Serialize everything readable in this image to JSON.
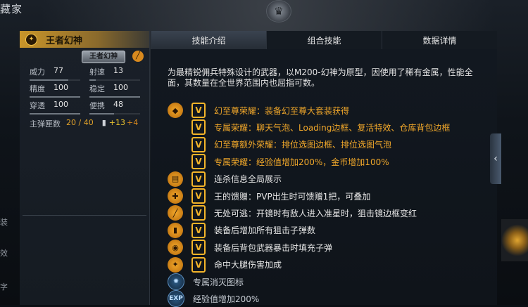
{
  "header": {
    "title": "藏家",
    "logo_icon": "lion-emblem-icon"
  },
  "side_hints": [
    "效",
    "字",
    "装"
  ],
  "weapon": {
    "name": "王者幻神",
    "badge": "王者幻神",
    "stats": [
      {
        "label": "威力",
        "value": "77",
        "level": 0.77
      },
      {
        "label": "射速",
        "value": "13",
        "level": 0.13
      },
      {
        "label": "精度",
        "value": "100",
        "level": 1.0
      },
      {
        "label": "稳定",
        "value": "100",
        "level": 1.0
      },
      {
        "label": "穿透",
        "value": "100",
        "level": 1.0
      },
      {
        "label": "便携",
        "value": "48",
        "level": 0.48
      }
    ],
    "ammo": {
      "label": "主弹匣数",
      "value": "20 / 40",
      "extra": "+13",
      "extra2": "+4"
    }
  },
  "tabs": [
    {
      "label": "技能介绍",
      "active": true
    },
    {
      "label": "组合技能",
      "active": false
    },
    {
      "label": "数据详情",
      "active": false
    }
  ],
  "description": "为最精锐佣兵特殊设计的武器，以M200-幻神为原型，因使用了稀有金属，性能全面，其数量在全世界范围内也屈指可数。",
  "features": [
    {
      "icon": "diamond-emblem-icon",
      "vip": true,
      "text": "幻至尊荣耀：装备幻至尊大套装获得",
      "color": "gold"
    },
    {
      "icon": "",
      "vip": true,
      "text": "专属荣耀：聊天气泡、Loading边框、复活特效、仓库背包边框",
      "color": "gold"
    },
    {
      "icon": "",
      "vip": true,
      "text": "幻至尊额外荣耀：排位选图边框、排位选图气泡",
      "color": "gold"
    },
    {
      "icon": "",
      "vip": true,
      "text": "专属荣耀：经验值增加200%，金币增加100%",
      "color": "gold"
    },
    {
      "icon": "killfeed-icon",
      "vip": true,
      "text": "连杀信息全局展示",
      "color": "white"
    },
    {
      "icon": "gift-icon",
      "vip": true,
      "text": "王的馈赠：PVP出生时可馈赠1把，可叠加",
      "color": "white"
    },
    {
      "icon": "sniper-scope-icon",
      "vip": true,
      "text": "无处可逃：开镜时有敌人进入准星时，狙击镜边框变红",
      "color": "white"
    },
    {
      "icon": "ammo-icon",
      "vip": true,
      "text": "装备后增加所有狙击子弹数",
      "color": "white"
    },
    {
      "icon": "backpack-icon",
      "vip": true,
      "text": "装备后背包武器暴击时填充子弹",
      "color": "white"
    },
    {
      "icon": "leg-shot-icon",
      "vip": true,
      "text": "命中大腿伤害加成",
      "color": "white"
    },
    {
      "icon": "kill-mark-icon",
      "vip": false,
      "text": "专属消灭图标",
      "color": "grey"
    },
    {
      "icon": "exp-icon",
      "vip": false,
      "text": "经验值增加200%",
      "color": "grey"
    }
  ],
  "feature_glyphs": {
    "diamond-emblem-icon": "◆",
    "killfeed-icon": "▤",
    "gift-icon": "✚",
    "sniper-scope-icon": "╱",
    "ammo-icon": "▮",
    "backpack-icon": "◉",
    "leg-shot-icon": "✦",
    "kill-mark-icon": "✺",
    "exp-icon": "EXP"
  },
  "vip_glyph": "V",
  "collapse_icon": "‹"
}
